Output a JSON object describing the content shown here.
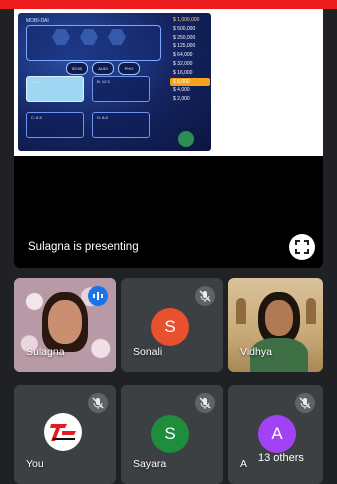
{
  "presentation": {
    "label": "Sulagna is presenting",
    "slide": {
      "logo": "MOBI-DAI",
      "lifelines": [
        "50:50",
        "AUDI",
        "PHO"
      ],
      "answers": [
        "A: 6.8",
        "B: 12.5",
        "C: 8.5",
        "D: 8.8"
      ],
      "ladder": [
        "$ 1,000,000",
        "$ 500,000",
        "$ 250,000",
        "$ 125,000",
        "$ 64,000",
        "$ 32,000",
        "$ 16,000",
        "$ 8,000",
        "$ 4,000",
        "$ 2,000"
      ]
    }
  },
  "participants": [
    {
      "name": "Sulagna",
      "initial": "",
      "status": "speaking"
    },
    {
      "name": "Sonali",
      "initial": "S",
      "color": "#e8502e",
      "status": "muted"
    },
    {
      "name": "Vidhya",
      "initial": "",
      "status": "camera"
    },
    {
      "name": "You",
      "initial": "",
      "status": "muted"
    },
    {
      "name": "Sayara",
      "initial": "S",
      "color": "#1e8e3e",
      "status": "muted"
    },
    {
      "name": "A",
      "initial": "A",
      "color": "#a142f4",
      "status": "muted"
    }
  ],
  "others_label": "13 others",
  "colors": {
    "accent": "#1a73e8",
    "topbar": "#ee1d1d",
    "background": "#202124",
    "tile": "#3c4043"
  }
}
